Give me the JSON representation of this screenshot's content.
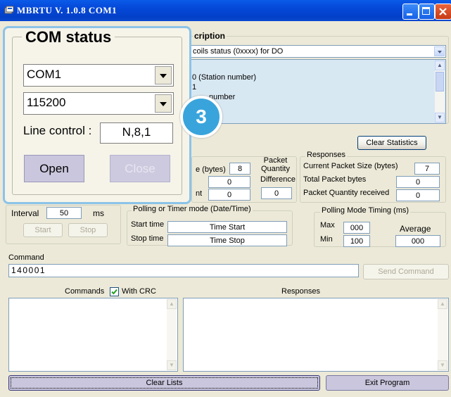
{
  "window": {
    "title": "MBRTU  V. 1.0.8  COM1"
  },
  "description": {
    "group_title": "cription",
    "function_select": "coils status (0xxxx)  for DO",
    "detail_lines": [
      "0 (Station number)",
      "1",
      "number"
    ]
  },
  "statistics": {
    "clear_label": "Clear Statistics",
    "sent_group": {
      "size_label": "e (bytes)",
      "size_value": "8",
      "packet_quantity_label": "Packet\nQuantity",
      "packet_quantity_value": "0",
      "difference_label": "Difference",
      "difference_value": "0",
      "cut_label": "nt",
      "cut_value": "0"
    },
    "responses": {
      "title": "Responses",
      "current_size_label": "Current Packet Size (bytes)",
      "current_size_value": "7",
      "total_bytes_label": "Total Packet bytes",
      "total_bytes_value": "0",
      "quantity_label": "Packet Quantity received",
      "quantity_value": "0"
    }
  },
  "interval": {
    "label": "Interval",
    "value": "50",
    "unit": "ms",
    "start": "Start",
    "stop": "Stop"
  },
  "polling": {
    "title": "Polling  or Timer mode  (Date/Time)",
    "start_label": "Start time",
    "start_value": "Time Start",
    "stop_label": "Stop time",
    "stop_value": "Time Stop"
  },
  "timing": {
    "title": "Polling Mode Timing (ms)",
    "max_label": "Max",
    "max_value": "000",
    "min_label": "Min",
    "min_value": "100",
    "average_label": "Average",
    "average_value": "000"
  },
  "command": {
    "label": "Command",
    "value": "140001",
    "send": "Send Command"
  },
  "commands_area": {
    "label": "Commands",
    "crc_label": "With CRC",
    "crc_checked": true
  },
  "responses_area": {
    "label": "Responses"
  },
  "footer": {
    "clear_lists": "Clear Lists",
    "exit": "Exit Program"
  },
  "com_status": {
    "title": "COM status",
    "port": "COM1",
    "baud": "115200",
    "line_control_label": "Line control :",
    "line_control_value": "N,8,1",
    "open": "Open",
    "close": "Close"
  },
  "callout": {
    "number": "3",
    "color": "#39A4DC"
  }
}
